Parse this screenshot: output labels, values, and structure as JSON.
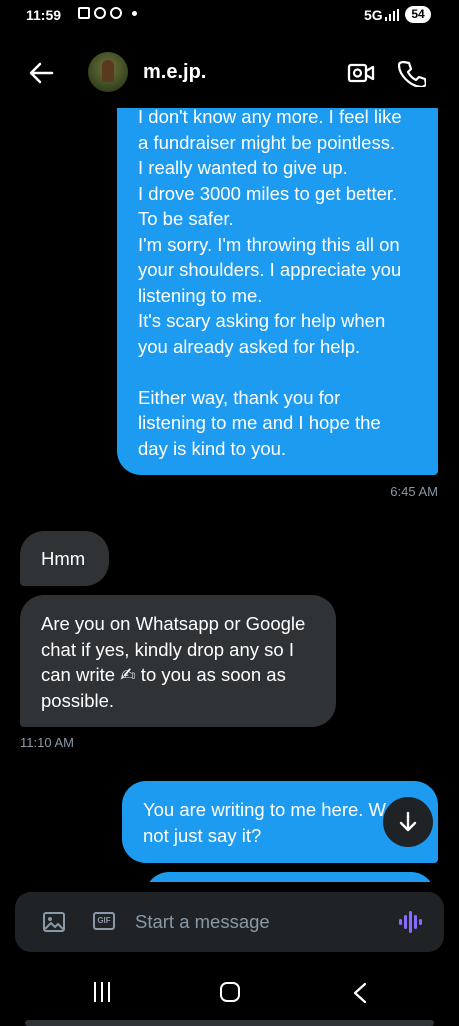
{
  "status_bar": {
    "time": "11:59",
    "network": "5G",
    "battery": "54"
  },
  "header": {
    "title": "m.e.jp."
  },
  "messages": [
    {
      "direction": "outgoing",
      "lines": [
        "I don't know any more. I feel like",
        "a fundraiser might be pointless.",
        "I really wanted to give up.",
        "I drove 3000 miles to get better.",
        "To be safer.",
        "I'm sorry. I'm throwing this all on",
        "your shoulders. I appreciate you",
        "listening to me.",
        "It's scary asking for help when",
        "you already asked for help.",
        "",
        "Either way, thank you for",
        "listening to me and I hope the",
        "day is kind to you."
      ],
      "timestamp": "6:45 AM"
    },
    {
      "direction": "incoming",
      "lines": [
        "Hmm"
      ]
    },
    {
      "direction": "incoming",
      "lines": [
        "Are you on Whatsapp or Google",
        "chat if yes, kindly drop any so I",
        "can write ✍ to you as soon as",
        "possible."
      ],
      "timestamp": "11:10 AM"
    },
    {
      "direction": "outgoing",
      "lines": [
        "You are writing to me here. W",
        "not just say it?"
      ]
    }
  ],
  "composer": {
    "placeholder": "Start a message",
    "gif_label": "GIF"
  },
  "colors": {
    "outgoing_bubble": "#1d9bf0",
    "incoming_bubble": "#2f3336",
    "voice_accent": "#8a6bff"
  },
  "icons": [
    "back-arrow-icon",
    "video-call-icon",
    "phone-icon",
    "arrow-down-icon",
    "image-icon",
    "gif-icon",
    "voice-icon",
    "recents-icon",
    "home-icon",
    "nav-back-icon"
  ]
}
